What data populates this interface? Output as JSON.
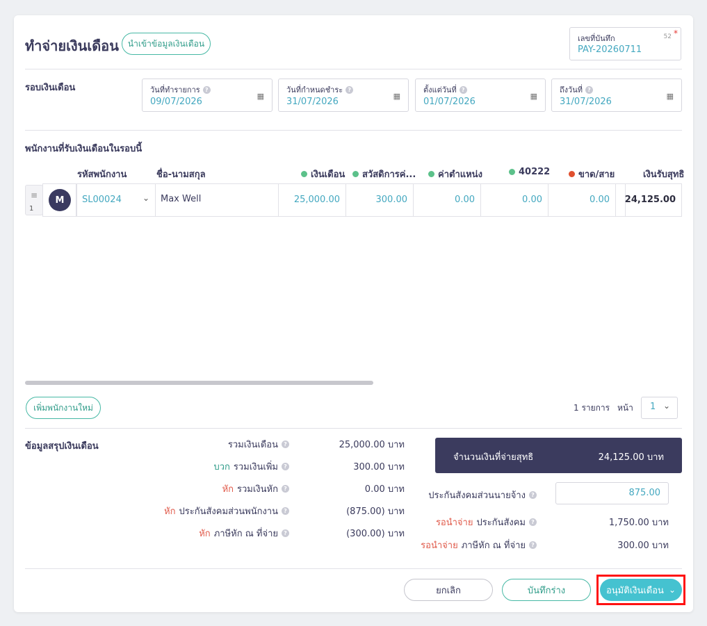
{
  "header": {
    "title": "ทำจ่ายเงินเดือน",
    "import_button": "นำเข้าข้อมูลเงินเดือน",
    "doc_no_label": "เลขที่บันทึก",
    "doc_no_count": "52",
    "doc_no_required": "*",
    "doc_no_value": "PAY-20260711"
  },
  "period": {
    "label": "รอบเงินเดือน",
    "fields": [
      {
        "label": "วันที่ทำรายการ",
        "value": "09/07/2026"
      },
      {
        "label": "วันที่กำหนดชำระ",
        "value": "31/07/2026"
      },
      {
        "label": "ตั้งแต่วันที่",
        "value": "01/07/2026"
      },
      {
        "label": "ถึงวันที่",
        "value": "31/07/2026"
      }
    ]
  },
  "employees": {
    "label": "พนักงานที่รับเงินเดือนในรอบนี้",
    "columns": {
      "code": "รหัสพนักงาน",
      "name": "ชื่อ-นามสกุล",
      "salary": "เงินเดือน",
      "welfare": "สวัสดิการค่...",
      "position": "ค่าตำแหน่ง",
      "c40222": "40222",
      "absent": "ขาด/สาย",
      "net": "เงินรับสุทธิ"
    },
    "colors": {
      "green": "#5cc18a",
      "red": "#e0502f"
    },
    "rows": [
      {
        "index": "1",
        "avatar": "M",
        "code": "SL00024",
        "name": "Max Well",
        "salary": "25,000.00",
        "welfare": "300.00",
        "position": "0.00",
        "c40222": "0.00",
        "absent": "0.00",
        "net": "24,125.00"
      }
    ],
    "add_button": "เพิ่มพนักงานใหม่",
    "pagination": {
      "count_text": "1 รายการ",
      "page_label": "หน้า",
      "page": "1"
    }
  },
  "summary": {
    "label": "ข้อมูลสรุปเงินเดือน",
    "lines": [
      {
        "prefix": "",
        "label": "รวมเงินเดือน",
        "value": "25,000.00 บาท"
      },
      {
        "prefix": "บวก",
        "label": "รวมเงินเพิ่ม",
        "value": "300.00 บาท"
      },
      {
        "prefix": "หัก",
        "label": "รวมเงินหัก",
        "value": "0.00 บาท"
      },
      {
        "prefix": "หัก",
        "label": "ประกันสังคมส่วนพนักงาน",
        "value": "(875.00) บาท"
      },
      {
        "prefix": "หัก",
        "label": "ภาษีหัก ณ ที่จ่าย",
        "value": "(300.00) บาท"
      }
    ],
    "net_label": "จำนวนเงินที่จ่ายสุทธิ",
    "net_value": "24,125.00 บาท",
    "employer_ss_label": "ประกันสังคมส่วนนายจ้าง",
    "employer_ss_value": "875.00",
    "pending": [
      {
        "prefix": "รอนำจ่าย",
        "label": "ประกันสังคม",
        "value": "1,750.00 บาท"
      },
      {
        "prefix": "รอนำจ่าย",
        "label": "ภาษีหัก ณ ที่จ่าย",
        "value": "300.00 บาท"
      }
    ]
  },
  "footer": {
    "cancel": "ยกเลิก",
    "draft": "บันทึกร่าง",
    "approve": "อนุมัติเงินเดือน"
  }
}
